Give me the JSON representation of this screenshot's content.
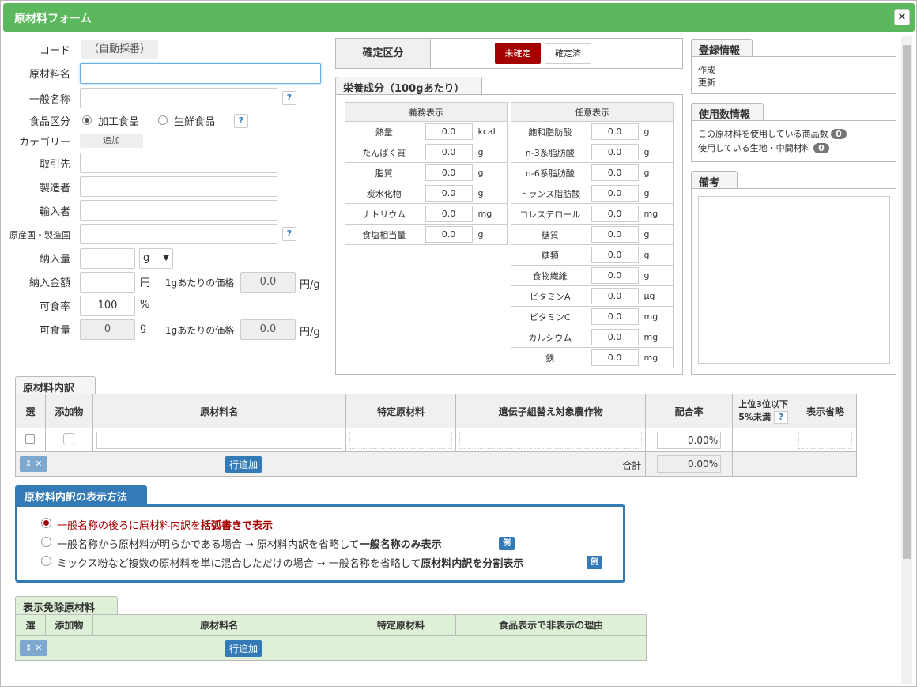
{
  "window": {
    "title": "原材料フォーム",
    "close": "×"
  },
  "form": {
    "code_label": "コード",
    "code_value": "（自動採番）",
    "name_label": "原材料名",
    "common_label": "一般名称",
    "foodtype_label": "食品区分",
    "foodtype_opt1": "加工食品",
    "foodtype_opt2": "生鮮食品",
    "category_label": "カテゴリー",
    "category_add": "追加",
    "supplier_label": "取引先",
    "maker_label": "製造者",
    "importer_label": "輸入者",
    "origin_label": "原産国・製造国",
    "qty_label": "納入量",
    "qty_unit": "g",
    "price_label": "納入金額",
    "price_unit": "円",
    "unit_price_label": "1gあたりの価格",
    "unit_price_value": "0.0",
    "unit_price_unit": "円/g",
    "edible_rate_label": "可食率",
    "edible_rate_value": "100",
    "edible_rate_unit": "%",
    "edible_qty_label": "可食量",
    "edible_qty_value": "0",
    "edible_qty_unit": "g",
    "unit_price2_label": "1gあたりの価格",
    "unit_price2_value": "0.0",
    "unit_price2_unit": "円/g",
    "help": "?"
  },
  "confirm": {
    "label": "確定区分",
    "unconfirmed": "未確定",
    "confirmed": "確定済"
  },
  "nutrition": {
    "title": "栄養成分（100gあたり）",
    "mandatory_header": "義務表示",
    "optional_header": "任意表示",
    "mandatory": [
      {
        "name": "熱量",
        "value": "0.0",
        "unit": "kcal"
      },
      {
        "name": "たんぱく質",
        "value": "0.0",
        "unit": "g"
      },
      {
        "name": "脂質",
        "value": "0.0",
        "unit": "g"
      },
      {
        "name": "炭水化物",
        "value": "0.0",
        "unit": "g"
      },
      {
        "name": "ナトリウム",
        "value": "0.0",
        "unit": "mg"
      },
      {
        "name": "食塩相当量",
        "value": "0.0",
        "unit": "g"
      }
    ],
    "optional": [
      {
        "name": "飽和脂肪酸",
        "value": "0.0",
        "unit": "g"
      },
      {
        "name": "n-3系脂肪酸",
        "value": "0.0",
        "unit": "g"
      },
      {
        "name": "n-6系脂肪酸",
        "value": "0.0",
        "unit": "g"
      },
      {
        "name": "トランス脂肪酸",
        "value": "0.0",
        "unit": "g"
      },
      {
        "name": "コレステロール",
        "value": "0.0",
        "unit": "mg"
      },
      {
        "name": "糖質",
        "value": "0.0",
        "unit": "g"
      },
      {
        "name": "糖類",
        "value": "0.0",
        "unit": "g"
      },
      {
        "name": "食物繊維",
        "value": "0.0",
        "unit": "g"
      },
      {
        "name": "ビタミンA",
        "value": "0.0",
        "unit": "μg"
      },
      {
        "name": "ビタミンC",
        "value": "0.0",
        "unit": "mg"
      },
      {
        "name": "カルシウム",
        "value": "0.0",
        "unit": "mg"
      },
      {
        "name": "鉄",
        "value": "0.0",
        "unit": "mg"
      }
    ]
  },
  "reg": {
    "title": "登録情報",
    "created": "作成",
    "updated": "更新"
  },
  "usage": {
    "title": "使用数情報",
    "products_label": "この原材料を使用している商品数",
    "products_count": "0",
    "dough_label": "使用している生地・中間材料",
    "dough_count": "0"
  },
  "notes": {
    "title": "備考"
  },
  "breakdown": {
    "title": "原材料内訳",
    "cols": [
      "選",
      "添加物",
      "原材料名",
      "特定原材料",
      "遺伝子組替え対象農作物",
      "配合率",
      "上位3位以下",
      "5%未満",
      "表示省略"
    ],
    "row_rate": "0.00",
    "pct": "%",
    "add_row": "行追加",
    "total_label": "合計",
    "total_value": "0.00"
  },
  "display": {
    "title": "原材料内訳の表示方法",
    "opt1_a": "一般名称の後ろに原材料内訳を",
    "opt1_b": "括弧書きで表示",
    "opt2_a": "一般名称から原材料が明らかである場合 → 原材料内訳を省略して",
    "opt2_b": "一般名称のみ表示",
    "opt3_a": "ミックス粉など複数の原材料を単に混合しただけの場合 → 一般名称を省略して",
    "opt3_b": "原材料内訳を分割表示",
    "example": "例"
  },
  "exempt": {
    "title": "表示免除原材料",
    "cols": [
      "選",
      "添加物",
      "原材料名",
      "特定原材料",
      "食品表示で非表示の理由"
    ],
    "add_row": "行追加"
  },
  "colors": {
    "header_green": "#5cb85c",
    "confirm_red": "#a50000",
    "primary_blue": "#337ab7",
    "exempt_green": "#dff0d8"
  }
}
